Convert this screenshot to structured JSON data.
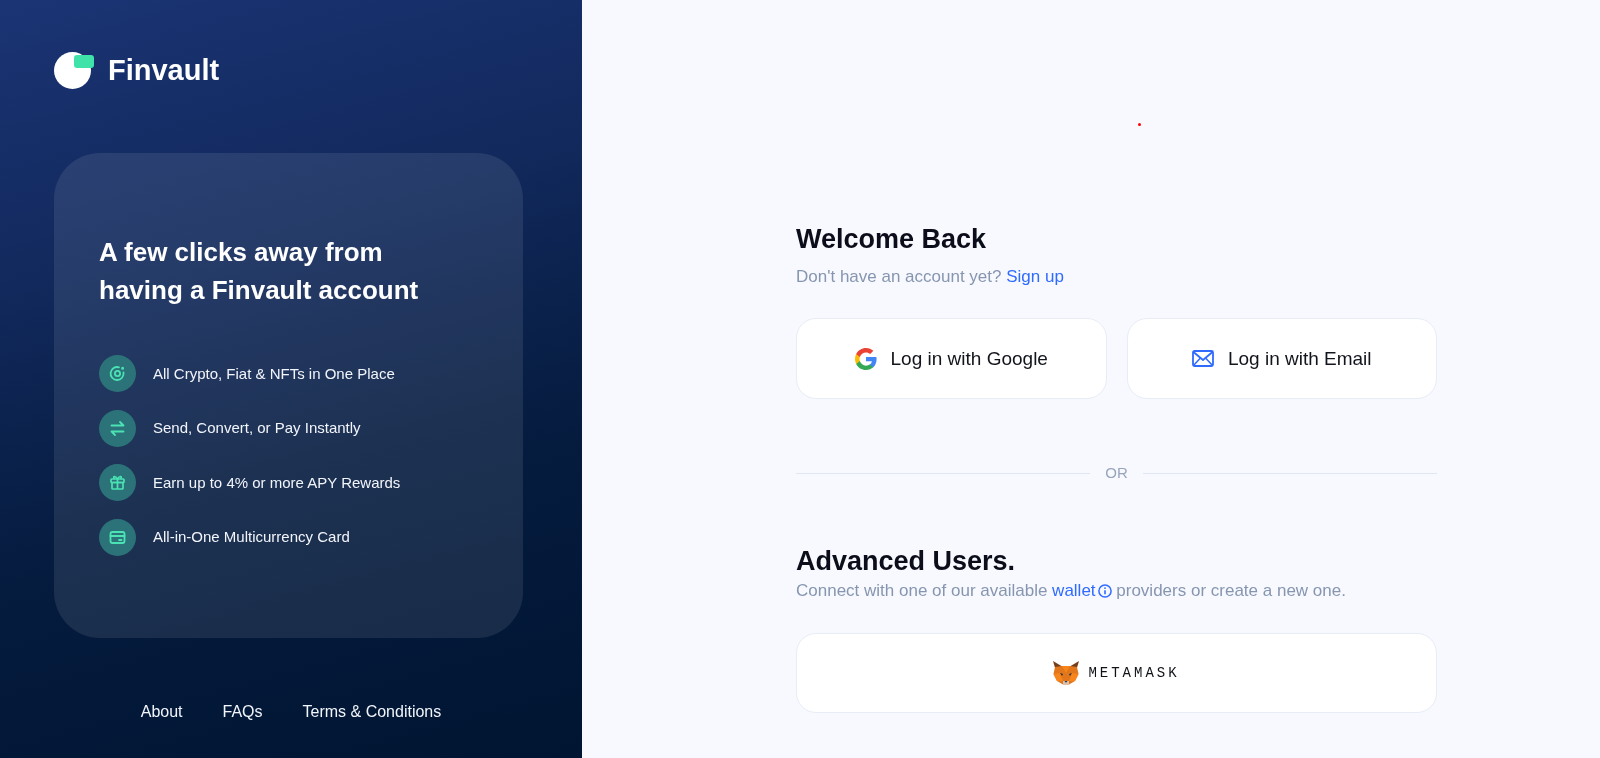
{
  "brand": {
    "name": "Finvault"
  },
  "promo": {
    "heading": "A few clicks away from having a Finvault account",
    "features": [
      {
        "kind": "target",
        "label": "All Crypto, Fiat & NFTs in One Place"
      },
      {
        "kind": "transfer",
        "label": "Send, Convert, or Pay Instantly"
      },
      {
        "kind": "gift",
        "label": "Earn up to 4% or more APY Rewards"
      },
      {
        "kind": "card",
        "label": "All-in-One Multicurrency Card"
      }
    ]
  },
  "footer_links": [
    "About",
    "FAQs",
    "Terms & Conditions"
  ],
  "login": {
    "title": "Welcome Back",
    "prompt": "Don't have an account yet?",
    "signup_link": "Sign up",
    "buttons": [
      {
        "kind": "google",
        "label": "Log in with Google"
      },
      {
        "kind": "email",
        "label": "Log in with Email"
      }
    ],
    "divider": "OR"
  },
  "advanced": {
    "title": "Advanced Users.",
    "text_before": "Connect with one of our available",
    "link": "wallet",
    "text_after": "providers or create a new one.",
    "wallets": [
      {
        "kind": "metamask",
        "label": "METAMASK"
      }
    ]
  }
}
